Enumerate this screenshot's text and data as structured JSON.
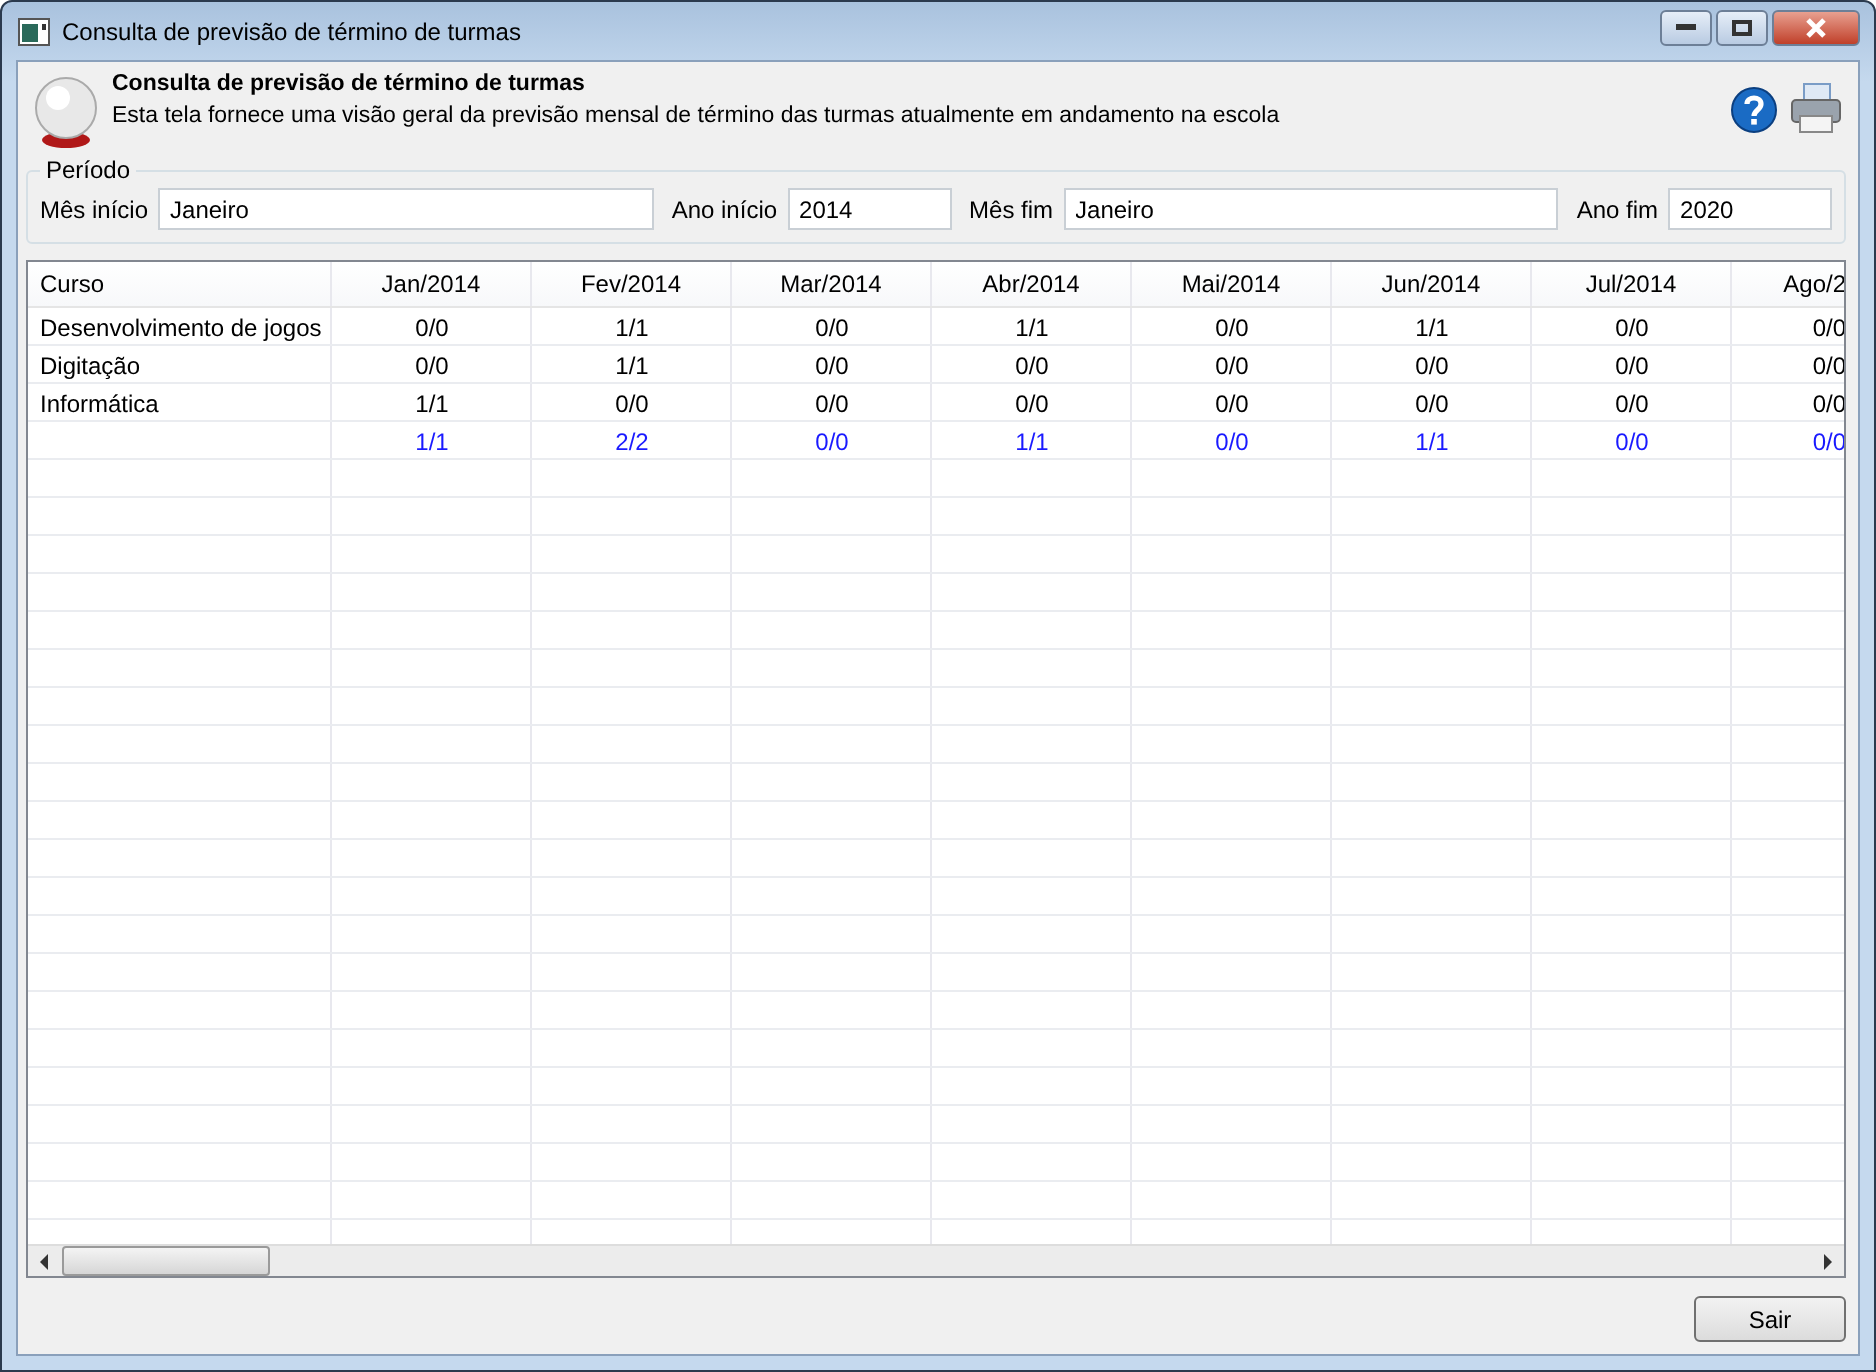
{
  "window": {
    "title": "Consulta de previsão de término de turmas"
  },
  "header": {
    "title": "Consulta de previsão de término de turmas",
    "description": "Esta tela fornece uma visão geral da previsão mensal de término das turmas atualmente em andamento na escola"
  },
  "period": {
    "legend": "Período",
    "fields": [
      {
        "label": "Mês início",
        "value": "Janeiro"
      },
      {
        "label": "Ano início",
        "value": "2014"
      },
      {
        "label": "Mês fim",
        "value": "Janeiro"
      },
      {
        "label": "Ano fim",
        "value": "2020"
      }
    ]
  },
  "table": {
    "columns": [
      "Curso",
      "Jan/2014",
      "Fev/2014",
      "Mar/2014",
      "Abr/2014",
      "Mai/2014",
      "Jun/2014",
      "Jul/2014",
      "Ago/2"
    ],
    "rows": [
      {
        "kind": "course",
        "course": "Desenvolvimento de jogos",
        "values": [
          "0/0",
          "1/1",
          "0/0",
          "1/1",
          "0/0",
          "1/1",
          "0/0",
          "0/0"
        ]
      },
      {
        "kind": "course",
        "course": "Digitação",
        "values": [
          "0/0",
          "1/1",
          "0/0",
          "0/0",
          "0/0",
          "0/0",
          "0/0",
          "0/0"
        ]
      },
      {
        "kind": "course",
        "course": "Informática",
        "values": [
          "1/1",
          "0/0",
          "0/0",
          "0/0",
          "0/0",
          "0/0",
          "0/0",
          "0/0"
        ]
      },
      {
        "kind": "total",
        "values": [
          "1/1",
          "2/2",
          "0/0",
          "1/1",
          "0/0",
          "1/1",
          "0/0",
          "0/0"
        ]
      }
    ]
  },
  "buttons": [
    {
      "label": "Sair"
    }
  ]
}
